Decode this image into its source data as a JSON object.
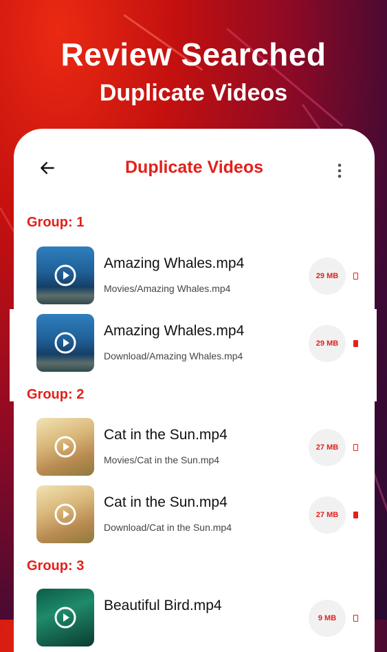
{
  "headline": {
    "line1": "Review Searched",
    "line2": "Duplicate Videos"
  },
  "appbar": {
    "back_icon": "arrow-left-icon",
    "title": "Duplicate Videos",
    "more_icon": "more-vertical-icon"
  },
  "groups": [
    {
      "label": "Group: 1",
      "items": [
        {
          "name": "Amazing Whales.mp4",
          "path": "Movies/Amazing Whales.mp4",
          "size": "29 MB",
          "selected": false
        },
        {
          "name": "Amazing Whales.mp4",
          "path": "Download/Amazing Whales.mp4",
          "size": "29 MB",
          "selected": true
        }
      ]
    },
    {
      "label": "Group: 2",
      "items": [
        {
          "name": "Cat in the Sun.mp4",
          "path": "Movies/Cat in the Sun.mp4",
          "size": "27 MB",
          "selected": false
        },
        {
          "name": "Cat in the Sun.mp4",
          "path": "Download/Cat in the Sun.mp4",
          "size": "27 MB",
          "selected": true
        }
      ]
    },
    {
      "label": "Group: 3",
      "items": [
        {
          "name": "Beautiful Bird.mp4",
          "path": "",
          "size": "9 MB",
          "selected": false
        }
      ]
    }
  ],
  "colors": {
    "accent": "#e3201b",
    "background_start": "#e4260f",
    "background_end": "#2a0a30"
  }
}
